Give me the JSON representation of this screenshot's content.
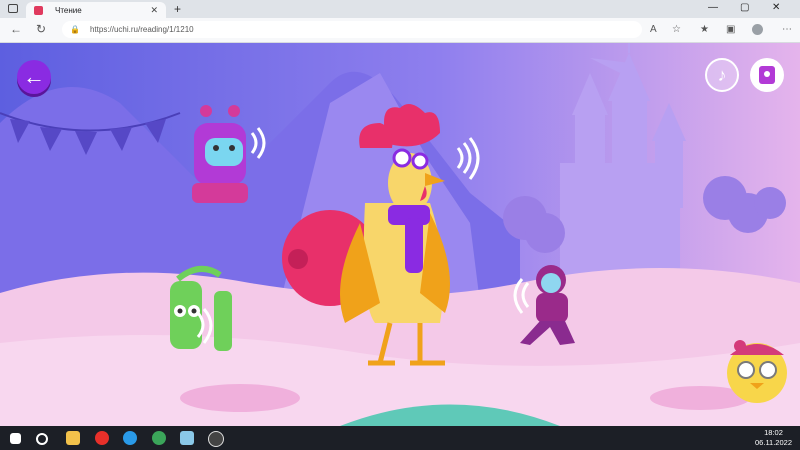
{
  "browser": {
    "tab_title": "Чтение",
    "tab_close": "✕",
    "new_tab": "+",
    "url": "https://uchi.ru/reading/1/1210",
    "window_controls": [
      "—",
      "▢",
      "✕"
    ],
    "nav": {
      "back": "←",
      "refresh": "↻"
    }
  },
  "game": {
    "back_button_icon": "←",
    "music_button_icon": "♪"
  },
  "taskbar": {
    "time": "18:02",
    "date": "06.11.2022",
    "apps": [
      "windows-start-icon",
      "search-icon",
      "file-explorer-icon",
      "yandex-browser-icon",
      "edge-browser-icon",
      "chrome-icon",
      "notepad-icon",
      "obs-icon"
    ]
  },
  "colors": {
    "sky": "#6c6ee6",
    "ground": "#f4c9e8",
    "castle": "#b197f3",
    "accent_purple": "#8a2be2",
    "taskbar": "#1c1f26"
  }
}
